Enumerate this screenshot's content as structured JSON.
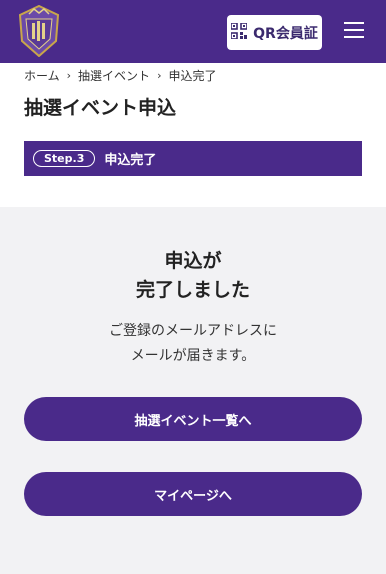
{
  "header": {
    "qr_label": "QR会員証",
    "qr_icon": "qr-code-icon",
    "menu_icon": "hamburger-menu-icon",
    "logo_icon": "club-crest-logo",
    "brand_color": "#4a2a8a"
  },
  "breadcrumb": {
    "items": [
      "ホーム",
      "抽選イベント",
      "申込完了"
    ],
    "separator_icon": "chevron-right-icon"
  },
  "page_title": "抽選イベント申込",
  "step": {
    "badge": "Step.3",
    "label": "申込完了"
  },
  "completion": {
    "heading_line1": "申込が",
    "heading_line2": "完了しました",
    "message_line1": "ご登録のメールアドレスに",
    "message_line2": "メールが届きます。"
  },
  "buttons": {
    "event_list": "抽選イベント一覧へ",
    "my_page": "マイページへ"
  }
}
